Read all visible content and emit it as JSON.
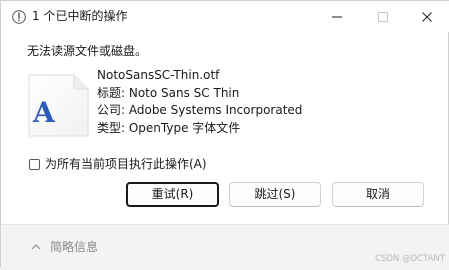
{
  "window": {
    "title": "1 个已中断的操作"
  },
  "dialog": {
    "message": "无法读源文件或磁盘。",
    "file": {
      "thumbnail_letter": "A",
      "name": "NotoSansSC-Thin.otf",
      "title_line": "标题: Noto Sans SC Thin",
      "company_line": "公司: Adobe Systems Incorporated",
      "type_line": "类型: OpenType 字体文件"
    },
    "apply_all_label": "为所有当前项目执行此操作(A)",
    "apply_all_checked": false,
    "buttons": {
      "retry": "重试(R)",
      "skip": "跳过(S)",
      "cancel": "取消"
    }
  },
  "footer": {
    "details_label": "简略信息",
    "watermark": "CSDN @DCTANT"
  },
  "colors": {
    "font_glyph": "#2c5cb8",
    "footer_bg": "#f3f3f3"
  }
}
